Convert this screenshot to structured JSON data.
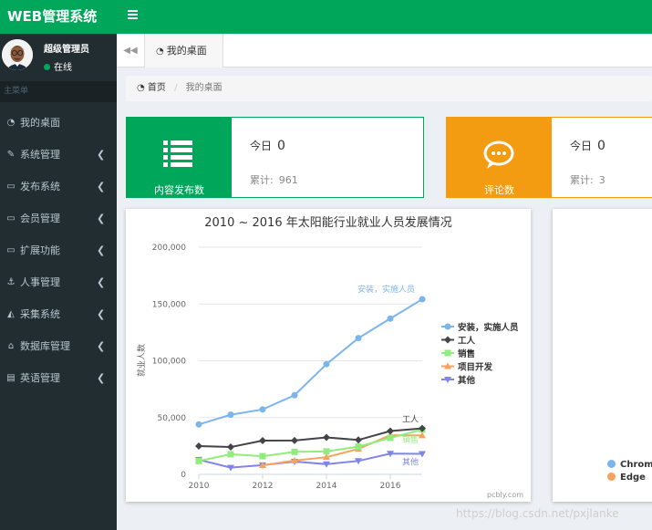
{
  "header": {
    "logo": "WEB管理系统"
  },
  "user": {
    "name": "超级管理员",
    "status": "在线"
  },
  "sidebar": {
    "header": "主菜单",
    "items": [
      {
        "label": "我的桌面",
        "icon": "dashboard-icon",
        "glyph": "◔",
        "expandable": false
      },
      {
        "label": "系统管理",
        "icon": "wrench-icon",
        "glyph": "✎",
        "expandable": true
      },
      {
        "label": "发布系统",
        "icon": "card-icon",
        "glyph": "▭",
        "expandable": true
      },
      {
        "label": "会员管理",
        "icon": "id-card-icon",
        "glyph": "▭",
        "expandable": true
      },
      {
        "label": "扩展功能",
        "icon": "hdd-icon",
        "glyph": "▭",
        "expandable": true
      },
      {
        "label": "人事管理",
        "icon": "anchor-icon",
        "glyph": "⚓",
        "expandable": true
      },
      {
        "label": "采集系统",
        "icon": "area-chart-icon",
        "glyph": "◭",
        "expandable": true
      },
      {
        "label": "数据库管理",
        "icon": "bank-icon",
        "glyph": "⌂",
        "expandable": true
      },
      {
        "label": "英语管理",
        "icon": "newspaper-icon",
        "glyph": "▤",
        "expandable": true
      }
    ]
  },
  "tabs": [
    {
      "label": "我的桌面",
      "icon": "dashboard-icon"
    }
  ],
  "breadcrumb": {
    "home": "首页",
    "current": "我的桌面"
  },
  "info_boxes": [
    {
      "label": "内容发布数",
      "today_label": "今日",
      "today_value": "0",
      "total_label": "累计:",
      "total_value": "961",
      "color": "#00a65a",
      "icon": "list-icon"
    },
    {
      "label": "评论数",
      "today_label": "今日",
      "today_value": "0",
      "total_label": "累计:",
      "total_value": "3",
      "color": "#f39c12",
      "icon": "comment-icon"
    }
  ],
  "chart_data": [
    {
      "type": "line",
      "title": "2010 ~ 2016 年太阳能行业就业人员发展情况",
      "ylabel": "就业人数",
      "xlabel": "",
      "x": [
        2010,
        2011,
        2012,
        2013,
        2014,
        2015,
        2016,
        2017
      ],
      "xticks": [
        "2010",
        "2012",
        "2014",
        "2016"
      ],
      "yticks": [
        "0",
        "50,000",
        "100,000",
        "150,000",
        "200,000"
      ],
      "xlim": [
        2010,
        2017
      ],
      "ylim": [
        0,
        200000
      ],
      "legend": "right",
      "grid": true,
      "credit": "pcbly.com",
      "series": [
        {
          "name": "安装，实施人员",
          "color": "#7cb5ec",
          "marker": "circle",
          "values": [
            43934,
            52503,
            57177,
            69658,
            97031,
            119931,
            137133,
            154175
          ]
        },
        {
          "name": "工人",
          "color": "#434348",
          "marker": "diamond",
          "values": [
            24916,
            24064,
            29742,
            29851,
            32490,
            30282,
            38121,
            40434
          ]
        },
        {
          "name": "销售",
          "color": "#90ed7d",
          "marker": "square",
          "values": [
            11744,
            17722,
            16005,
            19771,
            20185,
            24377,
            32147,
            39387
          ]
        },
        {
          "name": "项目开发",
          "color": "#f7a35c",
          "marker": "triangle",
          "values": [
            null,
            null,
            7988,
            12169,
            15112,
            22452,
            34400,
            34227
          ]
        },
        {
          "name": "其他",
          "color": "#8085e9",
          "marker": "triangle-down",
          "values": [
            12908,
            5948,
            8105,
            11248,
            8989,
            11816,
            18274,
            18111
          ]
        }
      ],
      "data_labels": [
        {
          "series": "安装，实施人员",
          "text": "安装，实施人员"
        },
        {
          "series": "工人",
          "text": "工人"
        },
        {
          "series": "销售",
          "text": "销售"
        },
        {
          "series": "其他",
          "text": "其他"
        }
      ]
    },
    {
      "type": "pie",
      "title": "",
      "legend": "bottom-left",
      "series": [
        {
          "name": "Chrome",
          "color": "#7cb5ec"
        },
        {
          "name": "Edge",
          "color": "#f7a35c"
        }
      ]
    }
  ],
  "watermark": "https://blog.csdn.net/pxjlanke"
}
